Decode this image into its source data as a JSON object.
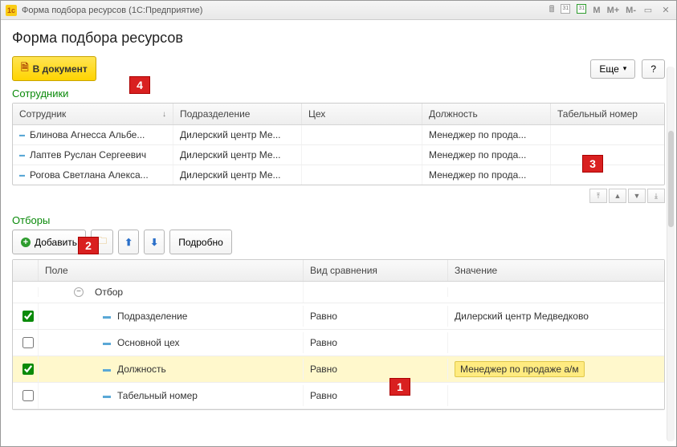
{
  "titlebar": {
    "app_icon": "1c",
    "title": "Форма подбора ресурсов  (1С:Предприятие)",
    "m_label": "M",
    "mplus_label": "M+",
    "mminus_label": "M-"
  },
  "header": {
    "title": "Форма подбора ресурсов"
  },
  "toolbar": {
    "to_document_label": "В документ",
    "more_label": "Еще",
    "help_label": "?"
  },
  "employees": {
    "section_title": "Сотрудники",
    "columns": {
      "name": "Сотрудник",
      "department": "Подразделение",
      "shop": "Цех",
      "position": "Должность",
      "tab_num": "Табельный номер"
    },
    "rows": [
      {
        "name": "Блинова Агнесса Альбе...",
        "department": "Дилерский центр Ме...",
        "shop": "",
        "position": "Менеджер по прода...",
        "tab_num": ""
      },
      {
        "name": "Лаптев Руслан Сергеевич",
        "department": "Дилерский центр Ме...",
        "shop": "",
        "position": "Менеджер по прода...",
        "tab_num": ""
      },
      {
        "name": "Рогова Светлана Алекса...",
        "department": "Дилерский центр Ме...",
        "shop": "",
        "position": "Менеджер по прода...",
        "tab_num": ""
      }
    ]
  },
  "filters": {
    "section_title": "Отборы",
    "add_label": "Добавить",
    "details_label": "Подробно",
    "columns": {
      "field": "Поле",
      "cmp": "Вид сравнения",
      "value": "Значение"
    },
    "root_label": "Отбор",
    "rows": [
      {
        "checked": true,
        "field": "Подразделение",
        "cmp": "Равно",
        "value": "Дилерский центр Медведково",
        "selected": false
      },
      {
        "checked": false,
        "field": "Основной цех",
        "cmp": "Равно",
        "value": "",
        "selected": false
      },
      {
        "checked": true,
        "field": "Должность",
        "cmp": "Равно",
        "value": "Менеджер по продаже а/м",
        "selected": true
      },
      {
        "checked": false,
        "field": "Табельный номер",
        "cmp": "Равно",
        "value": "",
        "selected": false
      }
    ]
  },
  "markers": {
    "m1": "1",
    "m2": "2",
    "m3": "3",
    "m4": "4"
  }
}
